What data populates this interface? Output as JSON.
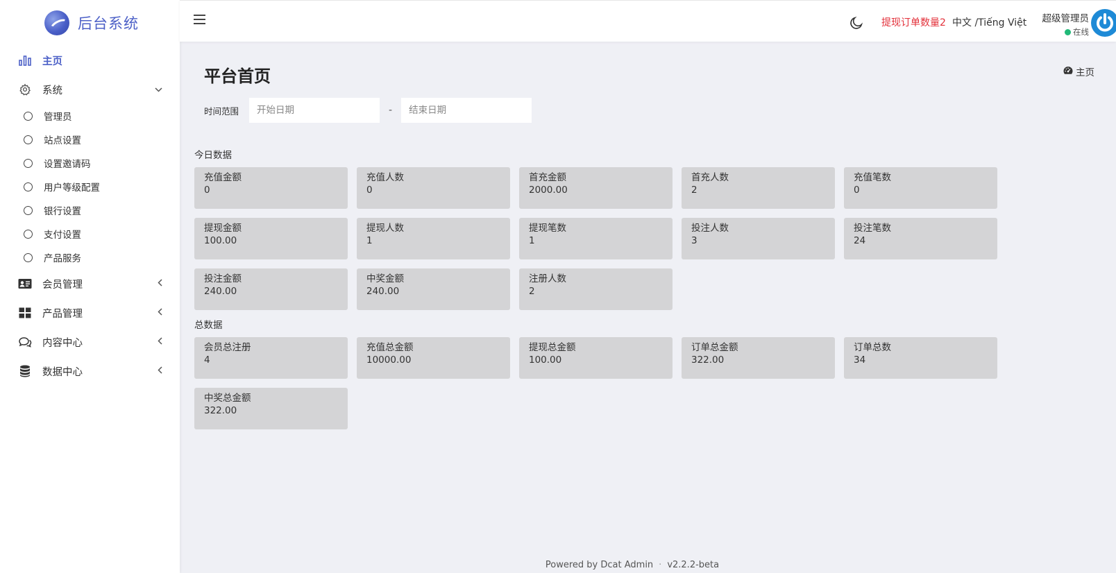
{
  "brand": {
    "title": "后台系统"
  },
  "sidebar": {
    "items": [
      {
        "label": "主页"
      },
      {
        "label": "系统"
      },
      {
        "label": "会员管理"
      },
      {
        "label": "产品管理"
      },
      {
        "label": "内容中心"
      },
      {
        "label": "数据中心"
      }
    ],
    "system_sub": [
      {
        "label": "管理员"
      },
      {
        "label": "站点设置"
      },
      {
        "label": "设置邀请码"
      },
      {
        "label": "用户等级配置"
      },
      {
        "label": "银行设置"
      },
      {
        "label": "支付设置"
      },
      {
        "label": "产品服务"
      }
    ]
  },
  "header": {
    "withdraw_alert": "提现订单数量2",
    "lang": "中文 /Tiếng Việt",
    "user_name": "超级管理员",
    "user_status": "在线"
  },
  "page": {
    "title": "平台首页",
    "breadcrumb": "主页"
  },
  "filter": {
    "label": "时间范围",
    "start_placeholder": "开始日期",
    "end_placeholder": "结束日期",
    "separator": "-"
  },
  "today": {
    "title": "今日数据",
    "cards": [
      {
        "title": "充值金额",
        "value": "0"
      },
      {
        "title": "充值人数",
        "value": "0"
      },
      {
        "title": "首充金额",
        "value": "2000.00"
      },
      {
        "title": "首充人数",
        "value": "2"
      },
      {
        "title": "充值笔数",
        "value": "0"
      },
      {
        "title": "提现金额",
        "value": "100.00"
      },
      {
        "title": "提现人数",
        "value": "1"
      },
      {
        "title": "提现笔数",
        "value": "1"
      },
      {
        "title": "投注人数",
        "value": "3"
      },
      {
        "title": "投注笔数",
        "value": "24"
      },
      {
        "title": "投注金额",
        "value": "240.00"
      },
      {
        "title": "中奖金额",
        "value": "240.00"
      },
      {
        "title": "注册人数",
        "value": "2"
      }
    ]
  },
  "total": {
    "title": "总数据",
    "cards": [
      {
        "title": "会员总注册",
        "value": "4"
      },
      {
        "title": "充值总金额",
        "value": "10000.00"
      },
      {
        "title": "提现总金额",
        "value": "100.00"
      },
      {
        "title": "订单总金额",
        "value": "322.00"
      },
      {
        "title": "订单总数",
        "value": "34"
      },
      {
        "title": "中奖总金额",
        "value": "322.00"
      }
    ]
  },
  "footer": {
    "powered": "Powered by Dcat Admin",
    "sep": "·",
    "version": "v2.2.2-beta"
  },
  "colors": {
    "accent": "#4c60c7",
    "alert": "#e3303a",
    "online": "#21b978",
    "card_bg": "#d4d4d6"
  }
}
